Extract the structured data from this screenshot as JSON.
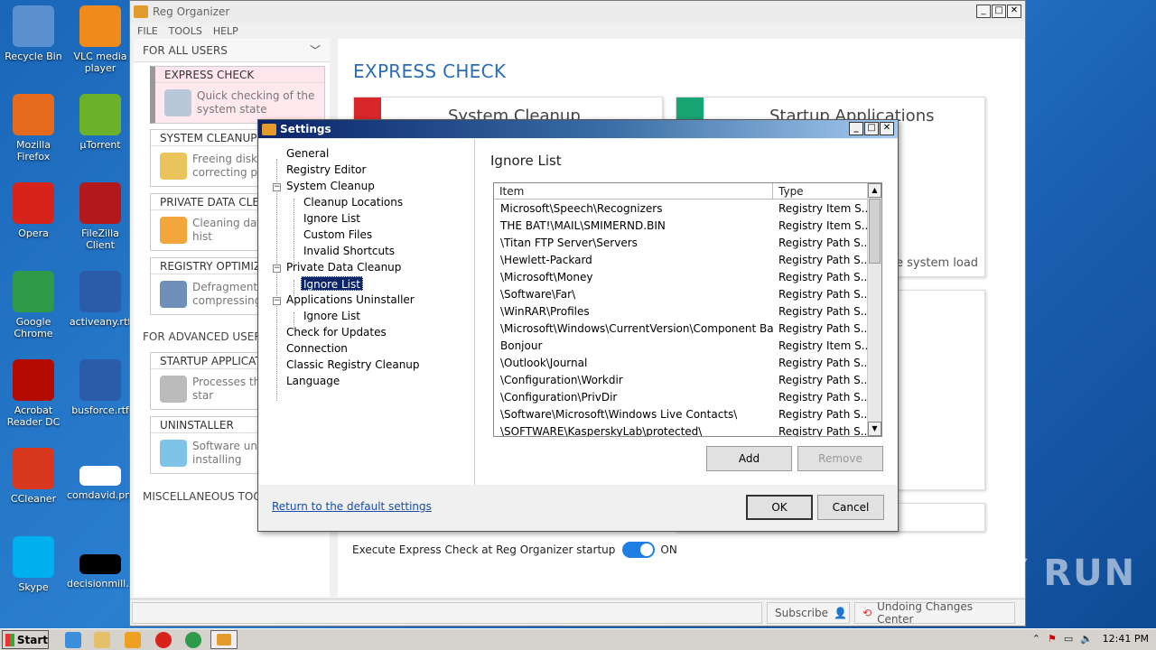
{
  "desktop": {
    "icons": [
      {
        "label": "Recycle Bin",
        "icon": "recycle-bin-icon",
        "color": "#5a8fd0"
      },
      {
        "label": "VLC media player",
        "icon": "vlc-icon",
        "color": "#f08a1a"
      },
      {
        "label": "Mozilla Firefox",
        "icon": "firefox-icon",
        "color": "#e66a1e"
      },
      {
        "label": "µTorrent",
        "icon": "utorrent-icon",
        "color": "#6bb22a"
      },
      {
        "label": "Opera",
        "icon": "opera-icon",
        "color": "#d8231b"
      },
      {
        "label": "FileZilla Client",
        "icon": "filezilla-icon",
        "color": "#b3181d"
      },
      {
        "label": "Google Chrome",
        "icon": "chrome-icon",
        "color": "#2e9b4a"
      },
      {
        "label": "activeany.rtf",
        "icon": "word-doc-icon",
        "color": "#2a5caa"
      },
      {
        "label": "Acrobat Reader DC",
        "icon": "acrobat-icon",
        "color": "#b30b00"
      },
      {
        "label": "busforce.rtf",
        "icon": "word-doc-icon",
        "color": "#2a5caa"
      },
      {
        "label": "CCleaner",
        "icon": "ccleaner-icon",
        "color": "#d9361e"
      },
      {
        "label": "comdavid.png",
        "icon": "image-file-icon",
        "color": "#ffffff"
      },
      {
        "label": "Skype",
        "icon": "skype-icon",
        "color": "#00aff0"
      },
      {
        "label": "decisionmill...",
        "icon": "black-file-icon",
        "color": "#000000"
      }
    ]
  },
  "app": {
    "title": "Reg Organizer",
    "menu": [
      "FILE",
      "TOOLS",
      "HELP"
    ],
    "for_all_users": "FOR ALL USERS",
    "left_items": [
      {
        "header": "EXPRESS CHECK",
        "desc": "Quick checking of the system state"
      },
      {
        "header": "SYSTEM CLEANUP",
        "desc": "Freeing disk s correcting pro"
      },
      {
        "header": "PRIVATE DATA CLEA",
        "desc": "Cleaning data browsing hist"
      },
      {
        "header": "REGISTRY OPTIMIZA",
        "desc": "Defragmentin compressing"
      }
    ],
    "for_advanced_users": "FOR ADVANCED USERS",
    "adv_items": [
      {
        "header": "STARTUP APPLICATIO",
        "desc": "Processes tha Windows star"
      },
      {
        "header": "UNINSTALLER",
        "desc": "Software unin and installing"
      }
    ],
    "misc": "MISCELLANEOUS TOOL",
    "main_title": "EXPRESS CHECK",
    "card1_title": "System Cleanup",
    "card2_title": "Startup Applications",
    "card2_text": "e system load",
    "toggle_label": "Execute Express Check at Reg Organizer startup",
    "toggle_state": "ON",
    "status_subscribe": "Subscribe",
    "status_undo": "Undoing Changes Center"
  },
  "dialog": {
    "title": "Settings",
    "tree": [
      {
        "label": "General"
      },
      {
        "label": "Registry Editor"
      },
      {
        "label": "System Cleanup"
      },
      {
        "label": "Cleanup Locations"
      },
      {
        "label": "Ignore List"
      },
      {
        "label": "Custom Files"
      },
      {
        "label": "Invalid Shortcuts"
      },
      {
        "label": "Private Data Cleanup"
      },
      {
        "label": "Ignore List"
      },
      {
        "label": "Applications Uninstaller"
      },
      {
        "label": "Ignore List"
      },
      {
        "label": "Check for Updates"
      },
      {
        "label": "Connection"
      },
      {
        "label": "Classic Registry Cleanup"
      },
      {
        "label": "Language"
      }
    ],
    "pane_title": "Ignore List",
    "columns": [
      "Item",
      "Type"
    ],
    "rows": [
      [
        "Microsoft\\Speech\\Recognizers",
        "Registry Item S..."
      ],
      [
        "THE BAT!\\MAIL\\SMIMERND.BIN",
        "Registry Item S..."
      ],
      [
        "\\Titan FTP Server\\Servers",
        "Registry Path S..."
      ],
      [
        "\\Hewlett-Packard",
        "Registry Path S..."
      ],
      [
        "\\Microsoft\\Money",
        "Registry Path S..."
      ],
      [
        "\\Software\\Far\\",
        "Registry Path S..."
      ],
      [
        "\\WinRAR\\Profiles",
        "Registry Path S..."
      ],
      [
        "\\Microsoft\\Windows\\CurrentVersion\\Component Base...",
        "Registry Path S..."
      ],
      [
        "Bonjour",
        "Registry Item S..."
      ],
      [
        "\\Outlook\\Journal",
        "Registry Path S..."
      ],
      [
        "\\Configuration\\Workdir",
        "Registry Path S..."
      ],
      [
        "\\Configuration\\PrivDir",
        "Registry Path S..."
      ],
      [
        "\\Software\\Microsoft\\Windows Live Contacts\\",
        "Registry Path S..."
      ],
      [
        "\\SOFTWARE\\KasperskyLab\\protected\\",
        "Registry Path S..."
      ]
    ],
    "add": "Add",
    "remove": "Remove",
    "reset_link": "Return to the default settings",
    "ok": "OK",
    "cancel": "Cancel"
  },
  "taskbar": {
    "start": "Start",
    "time": "12:41 PM"
  },
  "watermark": "ANY RUN"
}
